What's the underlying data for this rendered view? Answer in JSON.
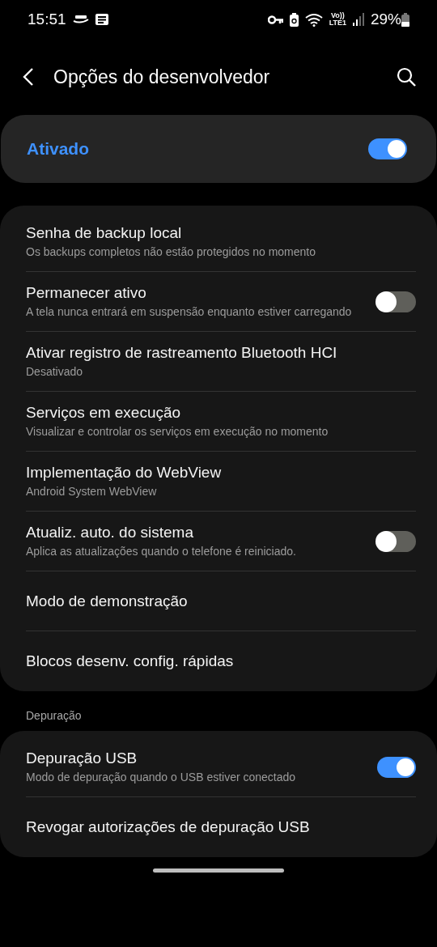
{
  "status_bar": {
    "time": "15:51",
    "network": "Vo))",
    "network_type": "LTE1",
    "battery": "29%"
  },
  "header": {
    "title": "Opções do desenvolvedor"
  },
  "master": {
    "label": "Ativado",
    "on": true
  },
  "groups": [
    {
      "items": [
        {
          "kind": "plain",
          "title": "Senha de backup local",
          "subtitle": "Os backups completos não estão protegidos no momento"
        },
        {
          "kind": "toggle",
          "title": "Permanecer ativo",
          "subtitle": "A tela nunca entrará em suspensão enquanto estiver carregando",
          "on": false
        },
        {
          "kind": "plain",
          "title": "Ativar registro de rastreamento Bluetooth HCI",
          "subtitle": "Desativado"
        },
        {
          "kind": "plain",
          "title": "Serviços em execução",
          "subtitle": "Visualizar e controlar os serviços em execução no momento"
        },
        {
          "kind": "plain",
          "title": "Implementação do WebView",
          "subtitle": "Android System WebView"
        },
        {
          "kind": "toggle",
          "title": "Atualiz. auto. do sistema",
          "subtitle": "Aplica as atualizações quando o telefone é reiniciado.",
          "on": false
        },
        {
          "kind": "plain",
          "title": "Modo de demonstração"
        },
        {
          "kind": "plain",
          "title": "Blocos desenv. config. rápidas"
        }
      ]
    },
    {
      "label": "Depuração",
      "items": [
        {
          "kind": "toggle",
          "title": "Depuração USB",
          "subtitle": "Modo de depuração quando o USB estiver conectado",
          "on": true
        },
        {
          "kind": "plain",
          "title": "Revogar autorizações de depuração USB"
        }
      ]
    }
  ]
}
